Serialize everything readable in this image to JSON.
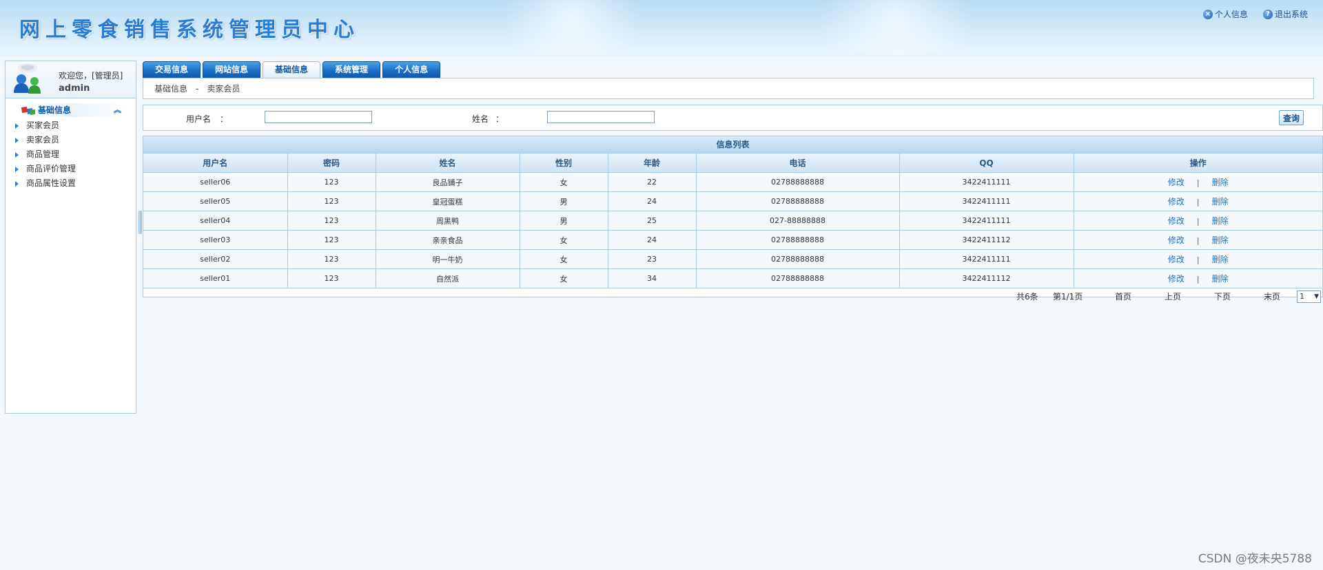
{
  "header": {
    "title": "网上零食销售系统管理员中心",
    "links": [
      {
        "icon": "close-circle-icon",
        "glyph": "×",
        "label": "个人信息"
      },
      {
        "icon": "help-circle-icon",
        "glyph": "?",
        "label": "退出系统"
      }
    ]
  },
  "sidebar": {
    "welcome": "欢迎您，[管理员]",
    "username": "admin",
    "menu_title": "基础信息",
    "menu_items": [
      "买家会员",
      "卖家会员",
      "商品管理",
      "商品评价管理",
      "商品属性设置"
    ]
  },
  "tabs": [
    "交易信息",
    "网站信息",
    "基础信息",
    "系统管理",
    "个人信息"
  ],
  "active_tab": "基础信息",
  "breadcrumb": {
    "section": "基础信息",
    "separator": "-",
    "page": "卖家会员"
  },
  "search": {
    "username_label": "用户名",
    "name_label": "姓名",
    "colon": "：",
    "username_value": "",
    "name_value": "",
    "button": "查询"
  },
  "table": {
    "caption": "信息列表",
    "columns": [
      "用户名",
      "密码",
      "姓名",
      "性别",
      "年龄",
      "电话",
      "QQ",
      "操作"
    ],
    "rows": [
      [
        "seller06",
        "123",
        "良品铺子",
        "女",
        "22",
        "02788888888",
        "3422411111"
      ],
      [
        "seller05",
        "123",
        "皇冠蛋糕",
        "男",
        "24",
        "02788888888",
        "3422411111"
      ],
      [
        "seller04",
        "123",
        "周黑鸭",
        "男",
        "25",
        "027-88888888",
        "3422411111"
      ],
      [
        "seller03",
        "123",
        "亲亲食品",
        "女",
        "24",
        "02788888888",
        "3422411112"
      ],
      [
        "seller02",
        "123",
        "明一牛奶",
        "女",
        "23",
        "02788888888",
        "3422411111"
      ],
      [
        "seller01",
        "123",
        "自然派",
        "女",
        "34",
        "02788888888",
        "3422411112"
      ]
    ],
    "edit_label": "修改",
    "delete_label": "删除",
    "action_separator": "|"
  },
  "pager": {
    "total": "共6条",
    "page_info": "第1/1页",
    "first": "首页",
    "prev": "上页",
    "next": "下页",
    "last": "末页",
    "current_page": "1",
    "dropdown_glyph": "▼"
  },
  "watermark": "CSDN @夜未央5788"
}
